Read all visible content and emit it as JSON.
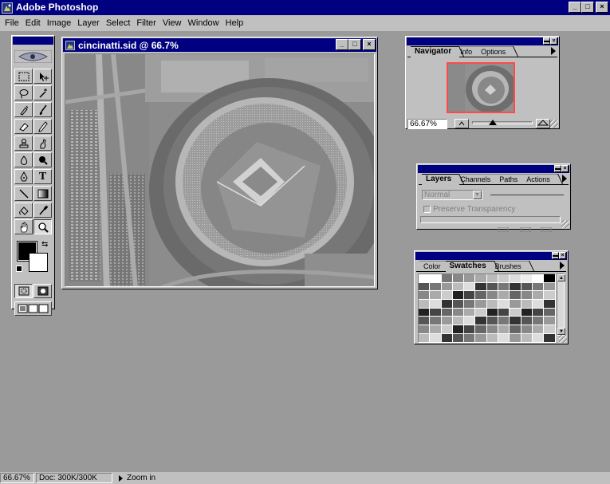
{
  "app": {
    "title": "Adobe Photoshop",
    "icon": "photoshop-icon"
  },
  "window_controls": {
    "minimize": "_",
    "maximize": "□",
    "close": "×"
  },
  "menu": [
    "File",
    "Edit",
    "Image",
    "Layer",
    "Select",
    "Filter",
    "View",
    "Window",
    "Help"
  ],
  "document": {
    "title": "cincinatti.sid @ 66.7%"
  },
  "status": {
    "zoom": "66.67%",
    "doc": "Doc: 300K/300K",
    "hint": "Zoom in"
  },
  "navigator": {
    "tabs": [
      "Navigator",
      "Info",
      "Options"
    ],
    "active_tab": "Navigator",
    "zoom_value": "66.67%",
    "zoom_out_icon": "mountain-small-icon",
    "zoom_in_icon": "mountain-large-icon",
    "view_box_color": "#ff4a4a"
  },
  "layers": {
    "tabs": [
      "Layers",
      "Channels",
      "Paths",
      "Actions"
    ],
    "active_tab": "Layers",
    "blend_mode": "Normal",
    "preserve_transparency": "Preserve Transparency"
  },
  "swatches_panel": {
    "tabs": [
      "Color",
      "Swatches",
      "Brushes"
    ],
    "active_tab": "Swatches"
  },
  "toolbox": {
    "tools": [
      "marquee-tool-icon",
      "move-tool-icon",
      "lasso-tool-icon",
      "magic-wand-tool-icon",
      "airbrush-tool-icon",
      "paintbrush-tool-icon",
      "eraser-tool-icon",
      "pencil-tool-icon",
      "rubber-stamp-tool-icon",
      "smudge-tool-icon",
      "dodge-tool-icon",
      "burn-tool-icon",
      "pen-tool-icon",
      "type-tool-icon",
      "line-tool-icon",
      "gradient-tool-icon",
      "paint-bucket-tool-icon",
      "eyedropper-tool-icon",
      "hand-tool-icon",
      "zoom-tool-icon"
    ],
    "foreground_color": "#000000",
    "background_color": "#ffffff"
  },
  "colors": {
    "titlebar": "#000080",
    "face": "#c0c0c0",
    "workspace": "#9a9a9a"
  }
}
